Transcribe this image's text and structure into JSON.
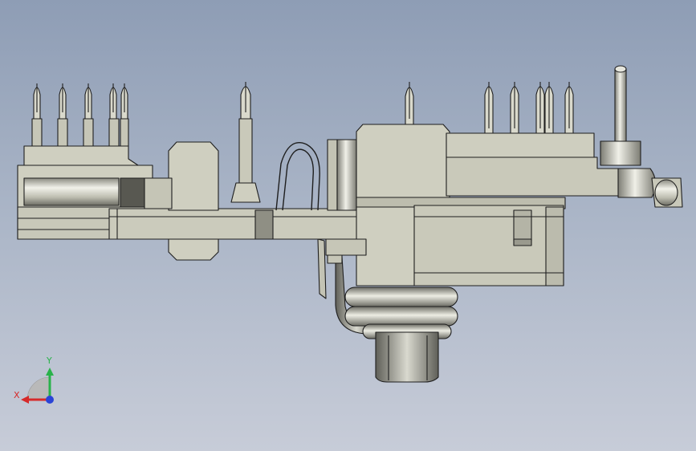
{
  "viewport": {
    "background_top": "#8e9db5",
    "background_bottom": "#c7ccd8",
    "part_fill": "#cfcfc0",
    "part_shade": "#a9a99a",
    "edge_color": "#1e1e1e"
  },
  "triad": {
    "x_label": "X",
    "y_label": "Y",
    "x_color": "#d62a2a",
    "y_color": "#29b24a",
    "z_color": "#2a44d6"
  }
}
